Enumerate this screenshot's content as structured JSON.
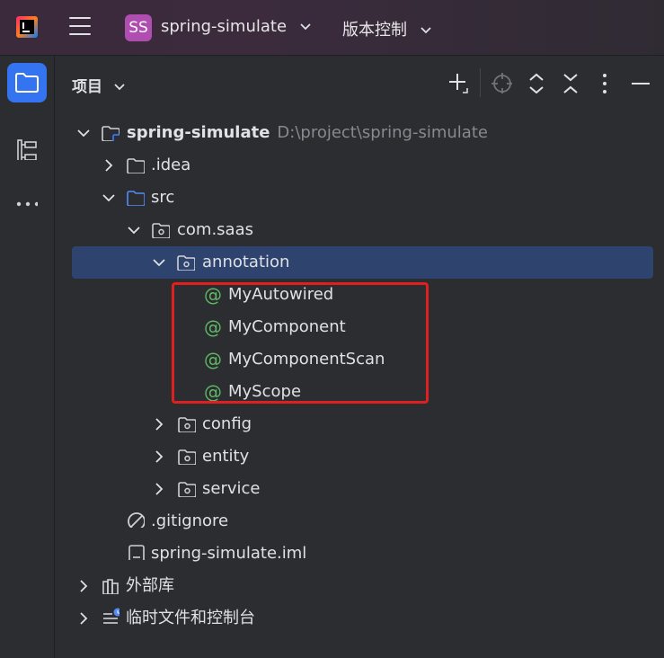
{
  "header": {
    "project_badge": "SS",
    "project_name": "spring-simulate",
    "vcs_label": "版本控制"
  },
  "panel": {
    "title": "项目"
  },
  "tree": {
    "root": {
      "name": "spring-simulate",
      "path": "D:\\project\\spring-simulate"
    },
    "idea": ".idea",
    "src": "src",
    "package": "com.saas",
    "annotation": "annotation",
    "annotations": [
      "MyAutowired",
      "MyComponent",
      "MyComponentScan",
      "MyScope"
    ],
    "config": "config",
    "entity": "entity",
    "service": "service",
    "gitignore": ".gitignore",
    "iml": "spring-simulate.iml",
    "external_libs": "外部库",
    "scratches": "临时文件和控制台"
  },
  "icons": [
    "intellij-logo-icon",
    "main-menu-icon",
    "chevron-down-icon",
    "project-folder-icon",
    "structure-icon",
    "more-icon",
    "add-icon",
    "locate-icon",
    "expand-all-icon",
    "collapse-all-icon",
    "options-icon",
    "hide-icon",
    "folder-icon",
    "package-icon",
    "annotation-icon",
    "ignore-file-icon",
    "module-file-icon",
    "library-icon",
    "scratch-icon"
  ],
  "colors": {
    "accent": "#3574f0",
    "selection": "#2e436e",
    "annotation": "#5fb865",
    "highlight_box": "#e02020",
    "project_badge": "#b04db0"
  }
}
